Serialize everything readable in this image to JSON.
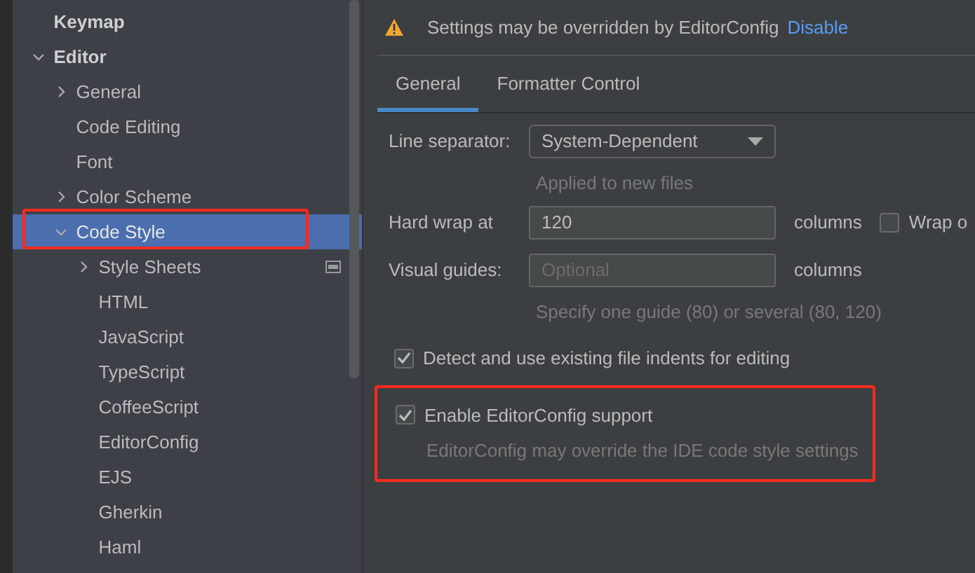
{
  "sidebar": {
    "items": [
      {
        "label": "Keymap",
        "bold": true,
        "selected": false,
        "highlighted": false
      },
      {
        "label": "Editor",
        "bold": true,
        "expanded": true,
        "selected": false,
        "highlighted": false,
        "children": [
          {
            "label": "General",
            "expanded": false,
            "selected": false,
            "highlighted": false
          },
          {
            "label": "Code Editing",
            "selected": false,
            "highlighted": false
          },
          {
            "label": "Font",
            "selected": false,
            "highlighted": false
          },
          {
            "label": "Color Scheme",
            "expanded": false,
            "selected": false,
            "highlighted": false
          },
          {
            "label": "Code Style",
            "expanded": true,
            "selected": true,
            "highlighted": true,
            "children": [
              {
                "label": "Style Sheets",
                "expanded": false,
                "selected": false,
                "highlighted": false,
                "project_icon": true
              },
              {
                "label": "HTML",
                "selected": false,
                "highlighted": false
              },
              {
                "label": "JavaScript",
                "selected": false,
                "highlighted": false
              },
              {
                "label": "TypeScript",
                "selected": false,
                "highlighted": false
              },
              {
                "label": "CoffeeScript",
                "selected": false,
                "highlighted": false
              },
              {
                "label": "EditorConfig",
                "selected": false,
                "highlighted": false
              },
              {
                "label": "EJS",
                "selected": false,
                "highlighted": false
              },
              {
                "label": "Gherkin",
                "selected": false,
                "highlighted": false
              },
              {
                "label": "Haml",
                "selected": false,
                "highlighted": false
              }
            ]
          }
        ]
      }
    ]
  },
  "banner": {
    "text": "Settings may be overridden by EditorConfig",
    "link": "Disable"
  },
  "tabs": [
    {
      "label": "General",
      "selected": true
    },
    {
      "label": "Formatter Control",
      "selected": false
    }
  ],
  "form": {
    "line_separator": {
      "label": "Line separator:",
      "value": "System-Dependent",
      "hint": "Applied to new files"
    },
    "hard_wrap": {
      "label": "Hard wrap at",
      "value": "120",
      "unit": "columns",
      "wrap_checkbox": {
        "label": "Wrap o",
        "checked": false
      }
    },
    "visual_guides": {
      "label": "Visual guides:",
      "placeholder": "Optional",
      "unit": "columns",
      "hint": "Specify one guide (80) or several (80, 120)"
    },
    "options": [
      {
        "label": "Detect and use existing file indents for editing",
        "checked": true,
        "highlighted": false
      },
      {
        "label": "Enable EditorConfig support",
        "checked": true,
        "highlighted": true,
        "description": "EditorConfig may override the IDE code style settings"
      }
    ]
  }
}
